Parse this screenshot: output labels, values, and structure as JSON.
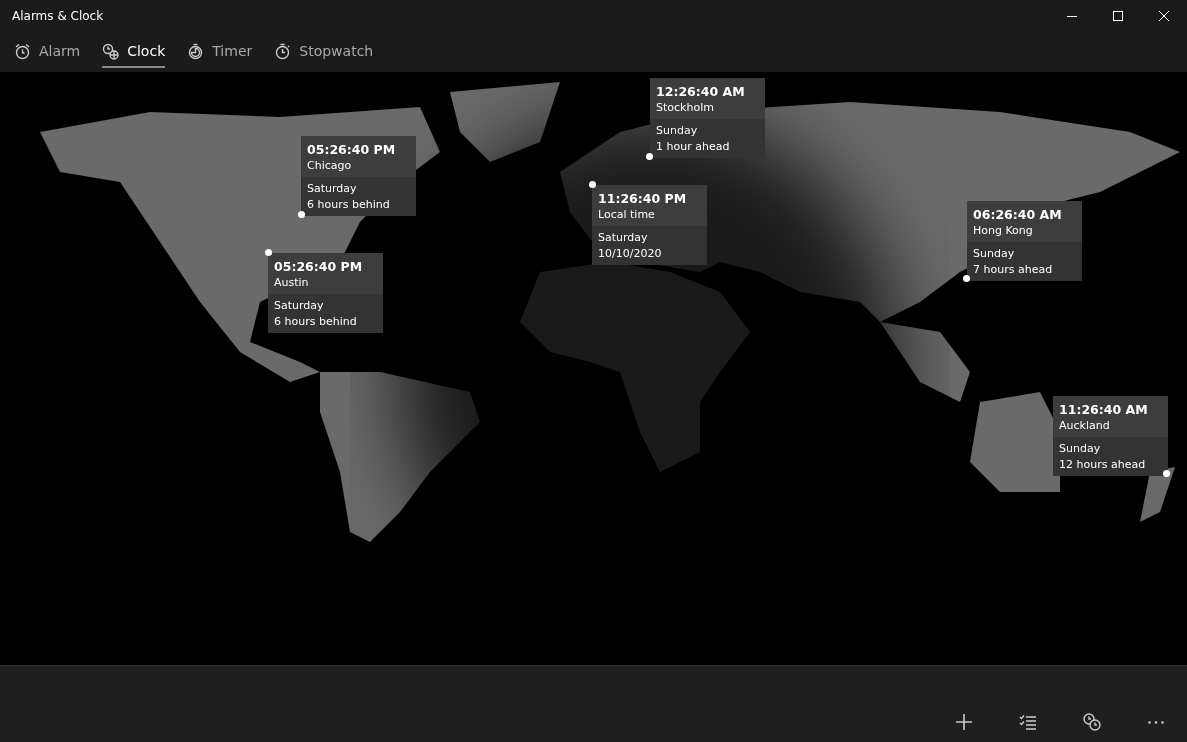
{
  "window": {
    "title": "Alarms & Clock"
  },
  "tabs": [
    {
      "label": "Alarm",
      "kind": "alarm",
      "selected": false
    },
    {
      "label": "Clock",
      "kind": "clock",
      "selected": true
    },
    {
      "label": "Timer",
      "kind": "timer",
      "selected": false
    },
    {
      "label": "Stopwatch",
      "kind": "stopwatch",
      "selected": false
    }
  ],
  "clocks": [
    {
      "time": "12:26:40 AM",
      "city": "Stockholm",
      "day": "Sunday",
      "offset": "1 hour ahead"
    },
    {
      "time": "05:26:40 PM",
      "city": "Chicago",
      "day": "Saturday",
      "offset": "6 hours behind"
    },
    {
      "time": "11:26:40 PM",
      "city": "Local time",
      "day": "Saturday",
      "offset": "10/10/2020"
    },
    {
      "time": "06:26:40 AM",
      "city": "Hong Kong",
      "day": "Sunday",
      "offset": "7 hours ahead"
    },
    {
      "time": "05:26:40 PM",
      "city": "Austin",
      "day": "Saturday",
      "offset": "6 hours behind"
    },
    {
      "time": "11:26:40 AM",
      "city": "Auckland",
      "day": "Sunday",
      "offset": "12 hours ahead"
    }
  ],
  "toolbar": [
    {
      "kind": "add"
    },
    {
      "kind": "select"
    },
    {
      "kind": "compare"
    },
    {
      "kind": "more"
    }
  ]
}
